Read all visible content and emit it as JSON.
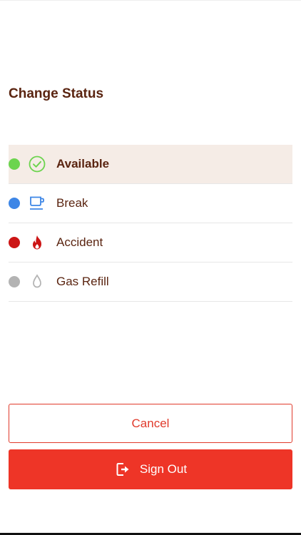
{
  "title": "Change Status",
  "statuses": [
    {
      "label": "Available",
      "dot_color": "#6cd44e",
      "icon": "check-circle-icon",
      "icon_color": "#6cd44e",
      "selected": true
    },
    {
      "label": "Break",
      "dot_color": "#3d86e6",
      "icon": "coffee-cup-icon",
      "icon_color": "#3d86e6",
      "selected": false
    },
    {
      "label": "Accident",
      "dot_color": "#cc1515",
      "icon": "flame-icon",
      "icon_color": "#cc1515",
      "selected": false
    },
    {
      "label": "Gas Refill",
      "dot_color": "#b3b3b3",
      "icon": "drop-icon",
      "icon_color": "#b3b3b3",
      "selected": false
    }
  ],
  "buttons": {
    "cancel_label": "Cancel",
    "signout_label": "Sign Out",
    "signout_icon": "sign-out-icon"
  },
  "colors": {
    "accent": "#ee3527",
    "text": "#5a2410",
    "selected_bg": "#f5ece6"
  }
}
